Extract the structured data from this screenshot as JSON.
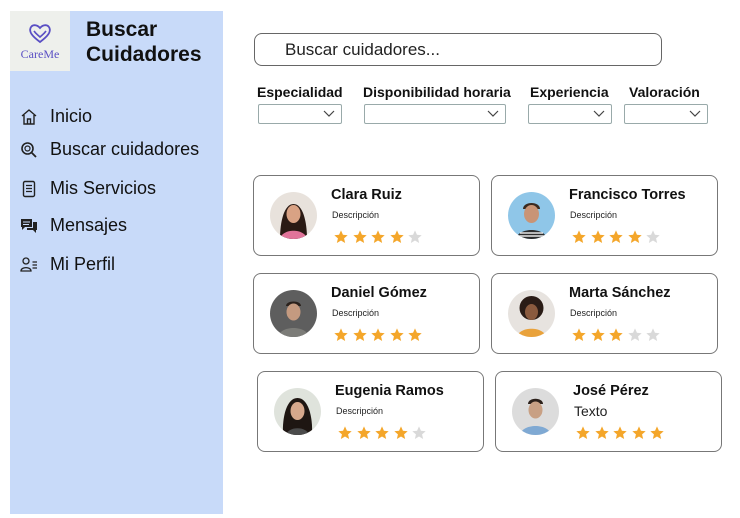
{
  "app": {
    "logo_text": "CareMe",
    "title_line1": "Buscar",
    "title_line2": "Cuidadores"
  },
  "sidebar": {
    "items": [
      {
        "label": "Inicio",
        "icon": "home-icon"
      },
      {
        "label": "Buscar cuidadores",
        "icon": "search-icon"
      },
      {
        "label": "Mis Servicios",
        "icon": "document-icon"
      },
      {
        "label": "Mensajes",
        "icon": "chat-icon"
      },
      {
        "label": "Mi Perfil",
        "icon": "user-list-icon"
      }
    ]
  },
  "search": {
    "placeholder": "Buscar cuidadores..."
  },
  "filters": [
    {
      "label": "Especialidad",
      "value": ""
    },
    {
      "label": "Disponibilidad horaria",
      "value": ""
    },
    {
      "label": "Experiencia",
      "value": ""
    },
    {
      "label": "Valoración",
      "value": ""
    }
  ],
  "caregivers": [
    {
      "name": "Clara Ruiz",
      "description": "Descripción",
      "rating": 4
    },
    {
      "name": "Francisco Torres",
      "description": "Descripción",
      "rating": 4
    },
    {
      "name": "Daniel Gómez",
      "description": "Descripción",
      "rating": 5
    },
    {
      "name": "Marta Sánchez",
      "description": "Descripción",
      "rating": 3
    },
    {
      "name": "Eugenia Ramos",
      "description": "Descripción",
      "rating": 4
    },
    {
      "name": "José Pérez",
      "description": "Texto",
      "rating": 5
    }
  ],
  "colors": {
    "sidebar_bg": "#c8daf9",
    "star_filled": "#f4a62a",
    "star_empty": "#d9d9d9",
    "logo_accent": "#5a4fc4"
  }
}
